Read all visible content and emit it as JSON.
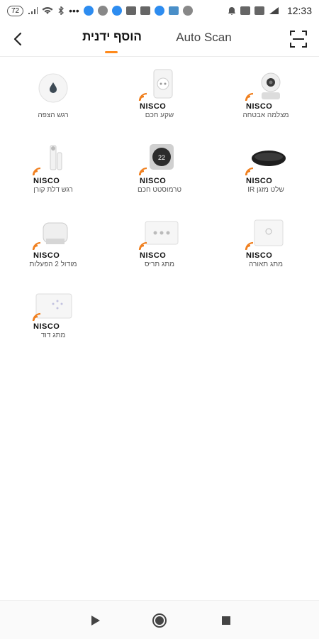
{
  "status_bar": {
    "battery": "72",
    "time": "12:33"
  },
  "header": {
    "tab_manual": "הוסף ידנית",
    "tab_auto": "Auto Scan",
    "accent_color": "#ff8a1c"
  },
  "brand_text": "NISCO",
  "devices": [
    {
      "label": "מצלמה אבטחה",
      "icon": "security-camera"
    },
    {
      "label": "שקע חכם",
      "icon": "smart-socket"
    },
    {
      "label": "רגש הצפה",
      "icon": "flood-sensor"
    },
    {
      "label": "שלט מזגן IR",
      "icon": "ir-remote"
    },
    {
      "label": "טרמוסטט חכם",
      "icon": "thermostat"
    },
    {
      "label": "רגש דלת קורן",
      "icon": "door-sensor"
    },
    {
      "label": "מתג תאורה",
      "icon": "light-switch"
    },
    {
      "label": "מתג תריס",
      "icon": "shutter-switch"
    },
    {
      "label": "מודול 2 הפעלות",
      "icon": "relay-module"
    },
    {
      "label": "מתג דוד",
      "icon": "boiler-switch"
    }
  ]
}
